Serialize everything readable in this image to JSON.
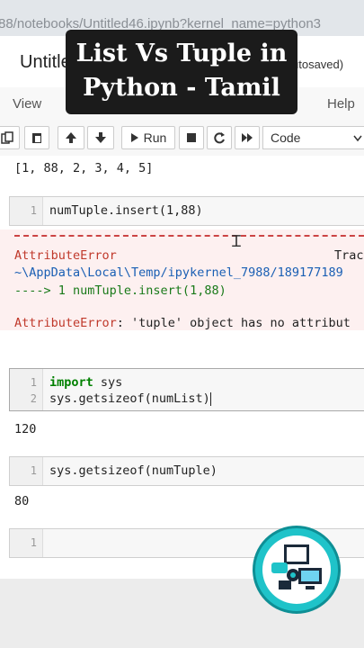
{
  "browser": {
    "url": "88/notebooks/Untitled46.ipynb?kernel_name=python3"
  },
  "notebook": {
    "title": "Untitle",
    "autosave_status": "utosaved)"
  },
  "menu": {
    "view_label": "View",
    "help_label": "Help"
  },
  "toolbar": {
    "run_label": "Run",
    "cell_type": "Code"
  },
  "banner": {
    "line1": "List Vs Tuple in",
    "line2": "Python - Tamil"
  },
  "cells": {
    "prev_output": "[1, 88, 2, 3, 4, 5]",
    "cell1": {
      "line1": "1",
      "code1": "numTuple.insert(1,88)"
    },
    "error": {
      "name": "AttributeError",
      "trace_label": "Trac",
      "path": "~\\AppData\\Local\\Temp/ipykernel_7988/189177189",
      "arrow_line": "----> 1 numTuple.insert(1,88)",
      "message_name": "AttributeError",
      "message_text": ": 'tuple' object has no attribut"
    },
    "cell2": {
      "line1": "1",
      "line2": "2",
      "kw1": "import",
      "code1": " sys",
      "code2": "sys.getsizeof(numList)",
      "output": "120"
    },
    "cell3": {
      "line1": "1",
      "code1": "sys.getsizeof(numTuple)",
      "output": "80"
    },
    "cell4": {
      "line1": "1"
    }
  },
  "icons": [
    "save-icon",
    "copy-icon",
    "paste-icon",
    "up-arrow-icon",
    "down-arrow-icon",
    "run-icon",
    "stop-icon",
    "restart-icon",
    "fast-forward-icon",
    "chevron-down-icon",
    "channel-logo-icon"
  ]
}
